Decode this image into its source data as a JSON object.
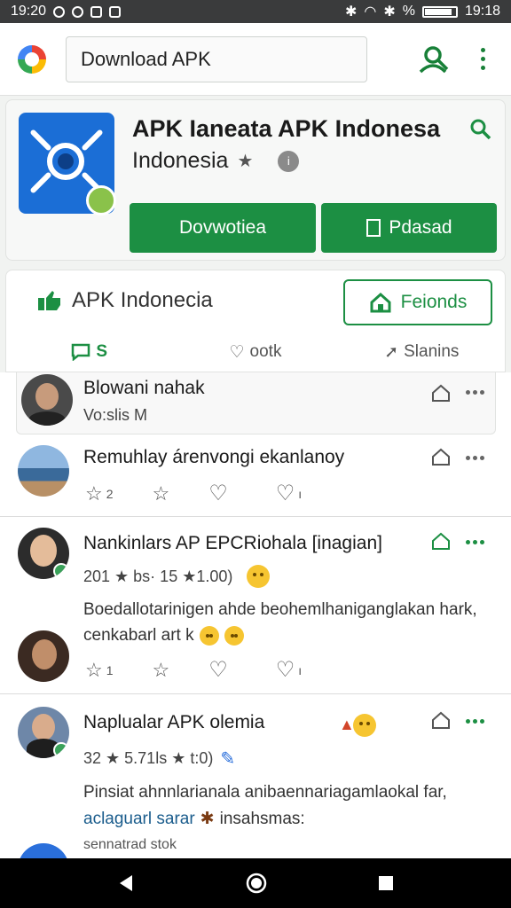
{
  "status_bar": {
    "time_left": "19:20",
    "time_right": "19:18"
  },
  "search": {
    "query": "Download APK"
  },
  "app": {
    "title": "APK Ianeata APK Indonesa",
    "subtitle": "Indonesia",
    "primary_button": "Dovwotiea",
    "secondary_button": "Pdasad"
  },
  "tabs_card": {
    "brand": "APK Indonecia",
    "friends_button": "Feionds",
    "tabs": [
      {
        "label": "S",
        "icon": "chat-icon"
      },
      {
        "label": "ootk",
        "icon": "heart-icon"
      },
      {
        "label": "Slanins",
        "icon": "share-icon"
      }
    ]
  },
  "posts": [
    {
      "name": "Blowani nahak",
      "meta": "Vo:slis M"
    },
    {
      "name": "Remuhlay árenvongi ekanlanoy",
      "likes": "2",
      "comments": "ı"
    },
    {
      "name": "Nankinlars AP EPCRiohala [inagian]",
      "meta": "201 ★ bs· 15 ★1.00)",
      "body1": "Boedallotarinigen ahde beohemlhaniganglakan hark,",
      "body2": "cenkabarl art k",
      "likes": "1",
      "comments": "ı"
    },
    {
      "name": "Naplualar APK olemia",
      "meta": "32 ★ 5.71ls ★ t:0)",
      "body1": "Pinsiat ahnnlarianala anibaennariagamlaokal far,",
      "body2": "aclaguarl sarar",
      "body2b": "insahsmas:",
      "body3": "sennatrad stok"
    }
  ],
  "colors": {
    "accent": "#1c8f43",
    "app_icon": "#1b6ed6"
  }
}
